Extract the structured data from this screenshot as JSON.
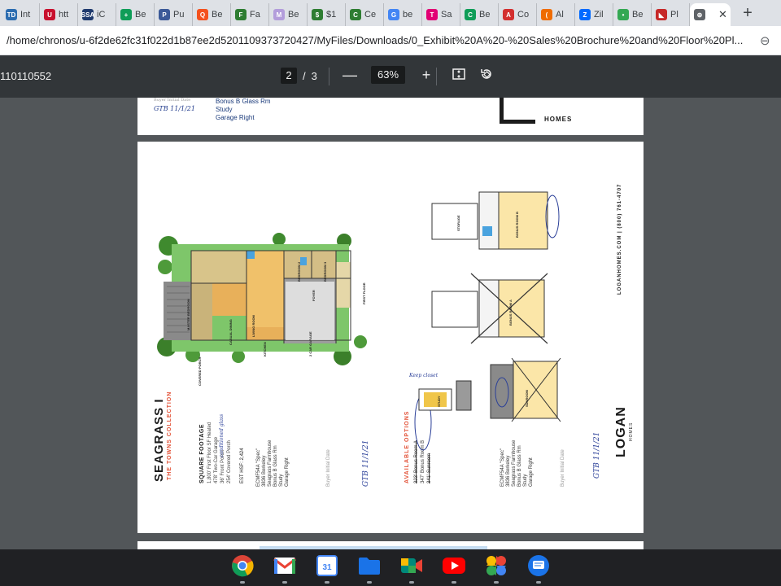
{
  "tabs": [
    {
      "label": "Int",
      "icon": "td-icon",
      "color": "#2b6cb0",
      "glyph": "TD"
    },
    {
      "label": "htt",
      "icon": "shield-icon",
      "color": "#c8102e",
      "glyph": "U"
    },
    {
      "label": "iC",
      "icon": "ssa-icon",
      "color": "#1f3a6e",
      "glyph": "SSA"
    },
    {
      "label": "Be",
      "icon": "sheets-icon",
      "color": "#0f9d58",
      "glyph": "+"
    },
    {
      "label": "Pu",
      "icon": "pu-icon",
      "color": "#3b5998",
      "glyph": "P"
    },
    {
      "label": "Be",
      "icon": "q-icon",
      "color": "#f4511e",
      "glyph": "Q"
    },
    {
      "label": "Fa",
      "icon": "cat-icon",
      "color": "#2e7d32",
      "glyph": "F"
    },
    {
      "label": "Be",
      "icon": "m-icon",
      "color": "#b39ddb",
      "glyph": "M"
    },
    {
      "label": "$1",
      "icon": "cat-icon",
      "color": "#2e7d32",
      "glyph": "$"
    },
    {
      "label": "Ce",
      "icon": "cat-icon",
      "color": "#2e7d32",
      "glyph": "C"
    },
    {
      "label": "be",
      "icon": "google-icon",
      "color": "#4285f4",
      "glyph": "G"
    },
    {
      "label": "Sa",
      "icon": "tmobile-icon",
      "color": "#e20074",
      "glyph": "T"
    },
    {
      "label": "Be",
      "icon": "c-icon",
      "color": "#0f9d58",
      "glyph": "C"
    },
    {
      "label": "Co",
      "icon": "a-icon",
      "color": "#d32f2f",
      "glyph": "A"
    },
    {
      "label": "Al",
      "icon": "circle-icon",
      "color": "#ef6c00",
      "glyph": "("
    },
    {
      "label": "Zil",
      "icon": "zillow-icon",
      "color": "#006aff",
      "glyph": "Z"
    },
    {
      "label": "Be",
      "icon": "maps-pin-icon",
      "color": "#34a853",
      "glyph": "•"
    },
    {
      "label": "Pl",
      "icon": "flag-icon",
      "color": "#c62828",
      "glyph": "◣"
    },
    {
      "label": "",
      "icon": "globe-icon",
      "color": "#5f6368",
      "glyph": "⊕",
      "active": true
    }
  ],
  "address": {
    "url": "/home/chronos/u-6f2de62fc31f022d1b87ee2d5201109373720427/MyFiles/Downloads/0_Exhibit%20A%20-%20Sales%20Brochure%20and%20Floor%20Pl..."
  },
  "pdf": {
    "title": "110110552",
    "page_current": "2",
    "page_sep": "/",
    "page_total": "3",
    "zoom": "63%"
  },
  "page1": {
    "lines": [
      "Bonus B Glass Rm",
      "Study",
      "Garage Right"
    ],
    "signature": "GTB 11/1/21",
    "sig_label": "Buyer Initial Date",
    "homes": "HOMES"
  },
  "page2": {
    "title": "SEAGRASS I",
    "collection": "THE TOWNS COLLECTION",
    "sqft_heading": "SQUARE FOOTAGE",
    "sqft_lines": [
      "1,800' First Floor SF Heated",
      "478' Two-Car Garage",
      "36' Front Porch",
      "254' Covered Porch"
    ],
    "sqft_note": "conditioned glass",
    "est_hsf": "EST HSF: 2,424",
    "spec1": [
      "ECMF54A \"Spec\"",
      "3836 Berkeley",
      "Seagrass Farmhouse",
      "Bonus B Glass Rm",
      "Study",
      "Garage Right"
    ],
    "sig1": "GTB 11/1/21",
    "buyer_label": "Buyer Initial Date",
    "options_heading": "AVAILABLE OPTIONS",
    "options": [
      "323' Bonus Room A",
      "347' Bonus Room B",
      "341' Sunroom"
    ],
    "keep_closet": "Keep closet",
    "spec2": [
      "ECMF54A \"Spec\"",
      "3836 Berkeley",
      "Seagrass Farmhouse",
      "Bonus B Glass Rm",
      "Study",
      "Garage Right"
    ],
    "sig2": "GTB 11/1/21",
    "logan": "LOGAN",
    "logan_homes": "HOMES",
    "contact": "LOGANHOMES.COM  |  (800) 761-4707",
    "rooms": {
      "master": "MASTER BEDROOM",
      "porch": "COVERED PORCH",
      "living": "LIVING ROOM",
      "dining": "CASUAL DINING",
      "kitchen": "KITCHEN",
      "garage": "2 CAR GARAGE",
      "bed2": "BEDROOM 2",
      "bed3": "BEDROOM 3",
      "foyer": "FOYER",
      "first_floor": "FIRST FLOOR",
      "bonus_b": "BONUS ROOM B",
      "bonus_a": "BONUS ROOM A",
      "study": "STUDY",
      "sunroom": "SUNROOM",
      "storage": "STORAGE"
    }
  },
  "shelf": [
    {
      "name": "chrome-app-icon"
    },
    {
      "name": "gmail-app-icon"
    },
    {
      "name": "calendar-app-icon",
      "label": "31"
    },
    {
      "name": "files-app-icon"
    },
    {
      "name": "meet-app-icon"
    },
    {
      "name": "youtube-app-icon"
    },
    {
      "name": "photos-app-icon"
    },
    {
      "name": "messages-app-icon"
    }
  ]
}
